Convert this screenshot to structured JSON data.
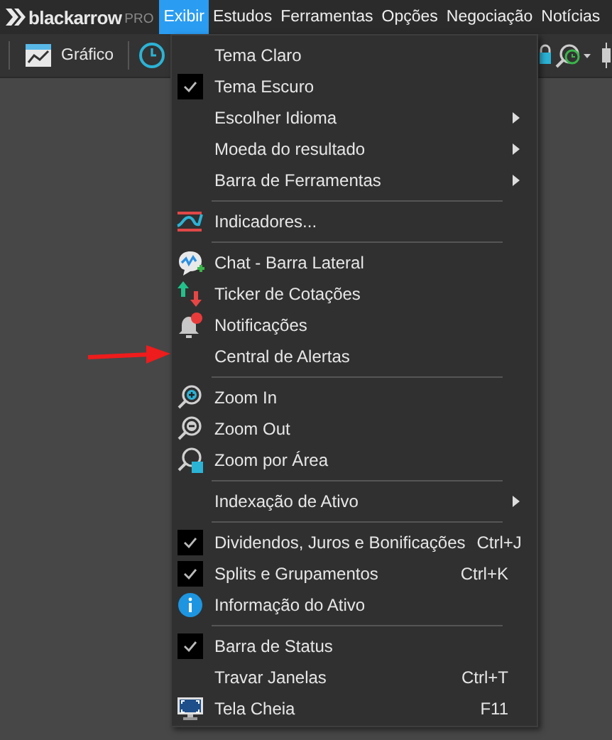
{
  "logo": {
    "name": "blackarrow",
    "suffix": "PRO"
  },
  "menubar": [
    {
      "label": "Exibir",
      "selected": true
    },
    {
      "label": "Estudos",
      "selected": false
    },
    {
      "label": "Ferramentas",
      "selected": false
    },
    {
      "label": "Opções",
      "selected": false
    },
    {
      "label": "Negociação",
      "selected": false
    },
    {
      "label": "Notícias",
      "selected": false
    }
  ],
  "toolbar": {
    "chart_button": "Gráfico"
  },
  "menu": [
    {
      "kind": "item",
      "label": "Tema Claro",
      "checked": false
    },
    {
      "kind": "item",
      "label": "Tema Escuro",
      "checked": true
    },
    {
      "kind": "item",
      "label": "Escolher Idioma",
      "checked": false,
      "submenu": true
    },
    {
      "kind": "item",
      "label": "Moeda do resultado",
      "checked": false,
      "submenu": true
    },
    {
      "kind": "item",
      "label": "Barra de Ferramentas",
      "checked": false,
      "submenu": true
    },
    {
      "kind": "separator"
    },
    {
      "kind": "item",
      "label": "Indicadores...",
      "checked": false
    },
    {
      "kind": "separator"
    },
    {
      "kind": "item",
      "label": "Chat - Barra Lateral",
      "checked": false
    },
    {
      "kind": "item",
      "label": "Ticker de Cotações",
      "checked": false
    },
    {
      "kind": "item",
      "label": "Notificações",
      "checked": false
    },
    {
      "kind": "item",
      "label": "Central de Alertas",
      "checked": false
    },
    {
      "kind": "separator"
    },
    {
      "kind": "item",
      "label": "Zoom In",
      "checked": false
    },
    {
      "kind": "item",
      "label": "Zoom Out",
      "checked": false
    },
    {
      "kind": "item",
      "label": "Zoom por Área",
      "checked": false
    },
    {
      "kind": "separator"
    },
    {
      "kind": "item",
      "label": "Indexação de Ativo",
      "checked": false,
      "submenu": true
    },
    {
      "kind": "separator"
    },
    {
      "kind": "item",
      "label": "Dividendos, Juros e Bonificações",
      "checked": true,
      "shortcut": "Ctrl+J"
    },
    {
      "kind": "item",
      "label": "Splits e Grupamentos",
      "checked": true,
      "shortcut": "Ctrl+K"
    },
    {
      "kind": "item",
      "label": "Informação do Ativo",
      "checked": false
    },
    {
      "kind": "separator"
    },
    {
      "kind": "item",
      "label": "Barra de Status",
      "checked": true
    },
    {
      "kind": "item",
      "label": "Travar Janelas",
      "checked": false,
      "shortcut": "Ctrl+T"
    },
    {
      "kind": "item",
      "label": "Tela Cheia",
      "checked": false,
      "shortcut": "F11"
    }
  ]
}
